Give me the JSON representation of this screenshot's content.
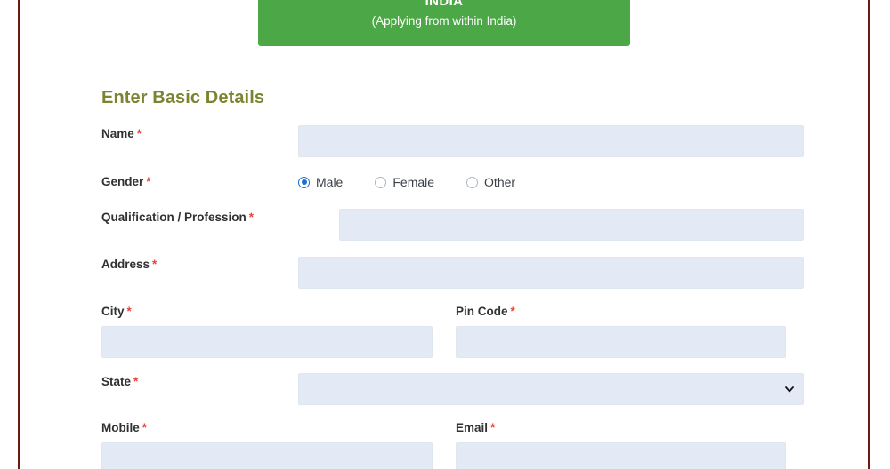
{
  "banner": {
    "country": "INDIA",
    "subtitle": "(Applying from within India)",
    "color": "#4ca746"
  },
  "section": {
    "heading": "Enter Basic Details",
    "heading_color": "#7c8431"
  },
  "required_marker": "*",
  "form": {
    "name": {
      "label": "Name",
      "value": "",
      "placeholder": ""
    },
    "gender": {
      "label": "Gender",
      "selected": "Male",
      "options": [
        {
          "label": "Male",
          "selected": true
        },
        {
          "label": "Female",
          "selected": false
        },
        {
          "label": "Other",
          "selected": false
        }
      ]
    },
    "qualification": {
      "label": "Qualification / Profession",
      "value": "",
      "placeholder": ""
    },
    "address": {
      "label": "Address",
      "value": "",
      "placeholder": ""
    },
    "city": {
      "label": "City",
      "value": "",
      "placeholder": ""
    },
    "pincode": {
      "label": "Pin Code",
      "value": "",
      "placeholder": ""
    },
    "state": {
      "label": "State",
      "value": "",
      "selected_option": "",
      "options": [
        ""
      ]
    },
    "mobile": {
      "label": "Mobile",
      "value": "",
      "placeholder": ""
    },
    "email": {
      "label": "Email",
      "value": "",
      "placeholder": ""
    }
  },
  "colors": {
    "input_fill": "#e3eaf6",
    "required_red": "#e8453c",
    "label_text": "#2f3133",
    "frame_rule": "#6b1b14",
    "radio_accent": "#1a6fd4"
  }
}
